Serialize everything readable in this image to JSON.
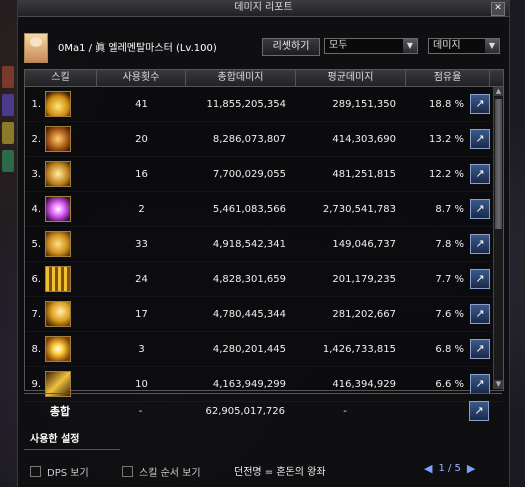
{
  "window": {
    "title": "데미지 리포트",
    "close": "✕"
  },
  "header": {
    "character": "0Ma1 / 眞 엘레멘탈마스터 (Lv.100)",
    "reset_label": "리셋하기",
    "filter_value": "모두",
    "metric_value": "데미지"
  },
  "columns": {
    "skill": "스킬",
    "count": "사용횟수",
    "total": "총합데미지",
    "avg": "평균데미지",
    "share": "점유율"
  },
  "rows": [
    {
      "idx": "1.",
      "count": "41",
      "total": "11,855,205,354",
      "avg": "289,151,350",
      "share": "18.8 %"
    },
    {
      "idx": "2.",
      "count": "20",
      "total": "8,286,073,807",
      "avg": "414,303,690",
      "share": "13.2 %"
    },
    {
      "idx": "3.",
      "count": "16",
      "total": "7,700,029,055",
      "avg": "481,251,815",
      "share": "12.2 %"
    },
    {
      "idx": "4.",
      "count": "2",
      "total": "5,461,083,566",
      "avg": "2,730,541,783",
      "share": "8.7 %"
    },
    {
      "idx": "5.",
      "count": "33",
      "total": "4,918,542,341",
      "avg": "149,046,737",
      "share": "7.8 %"
    },
    {
      "idx": "6.",
      "count": "24",
      "total": "4,828,301,659",
      "avg": "201,179,235",
      "share": "7.7 %"
    },
    {
      "idx": "7.",
      "count": "17",
      "total": "4,780,445,344",
      "avg": "281,202,667",
      "share": "7.6 %"
    },
    {
      "idx": "8.",
      "count": "3",
      "total": "4,280,201,445",
      "avg": "1,426,733,815",
      "share": "6.8 %"
    },
    {
      "idx": "9.",
      "count": "10",
      "total": "4,163,949,299",
      "avg": "416,394,929",
      "share": "6.6 %"
    }
  ],
  "totals": {
    "label": "총합",
    "count": "-",
    "total": "62,905,017,726",
    "avg": "-"
  },
  "used_settings_label": "사용한 설정",
  "bottom": {
    "dps_label": "DPS 보기",
    "order_label": "스킬 순서 보기",
    "dungeon": "던전명 = 혼돈의 왕좌",
    "page": "1 / 5",
    "prev": "◀",
    "next": "▶"
  },
  "icons": [
    "close-icon",
    "chevron-down-icon",
    "share-icon",
    "scroll-up-icon",
    "scroll-down-icon",
    "skill-icon"
  ]
}
